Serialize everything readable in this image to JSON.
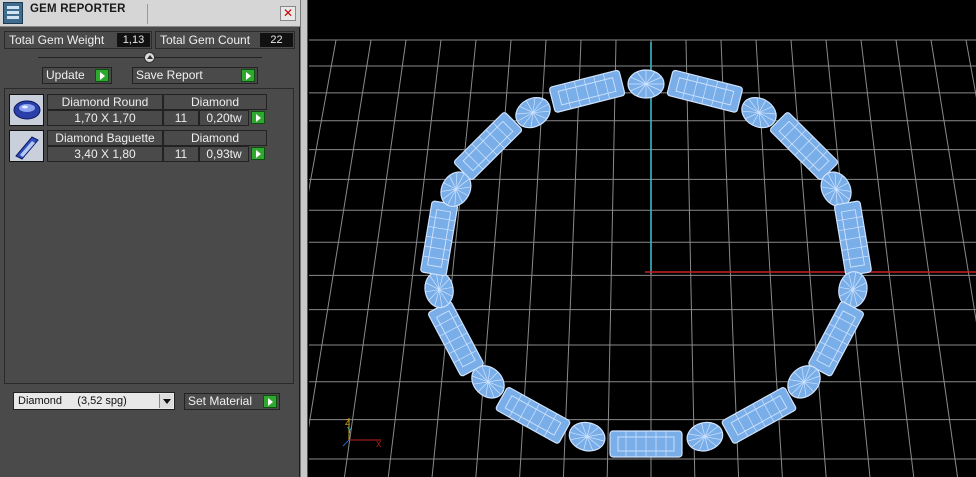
{
  "window": {
    "title": "GEM REPORTER",
    "close_glyph": "✕"
  },
  "totals": {
    "weight_label": "Total Gem Weight",
    "weight_value": "1,13",
    "count_label": "Total Gem Count",
    "count_value": "22"
  },
  "actions": {
    "update_label": "Update",
    "save_report_label": "Save Report"
  },
  "gems": [
    {
      "name": "Diamond Round",
      "material": "Diamond",
      "size": "1,70 X 1,70",
      "count": "11",
      "weight": "0,20tw",
      "icon": "round-gem-icon"
    },
    {
      "name": "Diamond Baguette",
      "material": "Diamond",
      "size": "3,40 X 1,80",
      "count": "11",
      "weight": "0,93tw",
      "icon": "baguette-gem-icon"
    }
  ],
  "material_select": {
    "value": "Diamond     (3,52 spg)"
  },
  "set_material_label": "Set Material",
  "axis_labels": {
    "z": "Z",
    "y": "Y",
    "x": "X"
  },
  "colors": {
    "grid": "#8a8a8a",
    "axis_y": "#3bb8c8",
    "axis_x": "#c82020",
    "gem_fill": "#7aaee8",
    "gem_edge": "#cfe3ff",
    "go_button": "#2ea82e"
  }
}
